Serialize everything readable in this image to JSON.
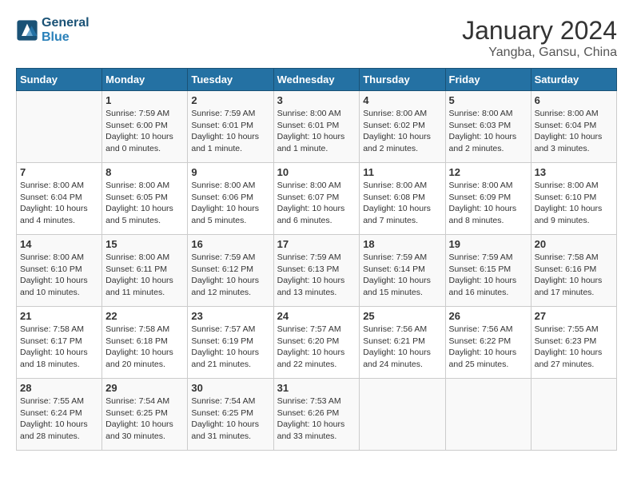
{
  "header": {
    "logo_line1": "General",
    "logo_line2": "Blue",
    "title": "January 2024",
    "subtitle": "Yangba, Gansu, China"
  },
  "days_of_week": [
    "Sunday",
    "Monday",
    "Tuesday",
    "Wednesday",
    "Thursday",
    "Friday",
    "Saturday"
  ],
  "weeks": [
    [
      {
        "day": "",
        "info": ""
      },
      {
        "day": "1",
        "info": "Sunrise: 7:59 AM\nSunset: 6:00 PM\nDaylight: 10 hours\nand 0 minutes."
      },
      {
        "day": "2",
        "info": "Sunrise: 7:59 AM\nSunset: 6:01 PM\nDaylight: 10 hours\nand 1 minute."
      },
      {
        "day": "3",
        "info": "Sunrise: 8:00 AM\nSunset: 6:01 PM\nDaylight: 10 hours\nand 1 minute."
      },
      {
        "day": "4",
        "info": "Sunrise: 8:00 AM\nSunset: 6:02 PM\nDaylight: 10 hours\nand 2 minutes."
      },
      {
        "day": "5",
        "info": "Sunrise: 8:00 AM\nSunset: 6:03 PM\nDaylight: 10 hours\nand 2 minutes."
      },
      {
        "day": "6",
        "info": "Sunrise: 8:00 AM\nSunset: 6:04 PM\nDaylight: 10 hours\nand 3 minutes."
      }
    ],
    [
      {
        "day": "7",
        "info": "Sunrise: 8:00 AM\nSunset: 6:04 PM\nDaylight: 10 hours\nand 4 minutes."
      },
      {
        "day": "8",
        "info": "Sunrise: 8:00 AM\nSunset: 6:05 PM\nDaylight: 10 hours\nand 5 minutes."
      },
      {
        "day": "9",
        "info": "Sunrise: 8:00 AM\nSunset: 6:06 PM\nDaylight: 10 hours\nand 5 minutes."
      },
      {
        "day": "10",
        "info": "Sunrise: 8:00 AM\nSunset: 6:07 PM\nDaylight: 10 hours\nand 6 minutes."
      },
      {
        "day": "11",
        "info": "Sunrise: 8:00 AM\nSunset: 6:08 PM\nDaylight: 10 hours\nand 7 minutes."
      },
      {
        "day": "12",
        "info": "Sunrise: 8:00 AM\nSunset: 6:09 PM\nDaylight: 10 hours\nand 8 minutes."
      },
      {
        "day": "13",
        "info": "Sunrise: 8:00 AM\nSunset: 6:10 PM\nDaylight: 10 hours\nand 9 minutes."
      }
    ],
    [
      {
        "day": "14",
        "info": "Sunrise: 8:00 AM\nSunset: 6:10 PM\nDaylight: 10 hours\nand 10 minutes."
      },
      {
        "day": "15",
        "info": "Sunrise: 8:00 AM\nSunset: 6:11 PM\nDaylight: 10 hours\nand 11 minutes."
      },
      {
        "day": "16",
        "info": "Sunrise: 7:59 AM\nSunset: 6:12 PM\nDaylight: 10 hours\nand 12 minutes."
      },
      {
        "day": "17",
        "info": "Sunrise: 7:59 AM\nSunset: 6:13 PM\nDaylight: 10 hours\nand 13 minutes."
      },
      {
        "day": "18",
        "info": "Sunrise: 7:59 AM\nSunset: 6:14 PM\nDaylight: 10 hours\nand 15 minutes."
      },
      {
        "day": "19",
        "info": "Sunrise: 7:59 AM\nSunset: 6:15 PM\nDaylight: 10 hours\nand 16 minutes."
      },
      {
        "day": "20",
        "info": "Sunrise: 7:58 AM\nSunset: 6:16 PM\nDaylight: 10 hours\nand 17 minutes."
      }
    ],
    [
      {
        "day": "21",
        "info": "Sunrise: 7:58 AM\nSunset: 6:17 PM\nDaylight: 10 hours\nand 18 minutes."
      },
      {
        "day": "22",
        "info": "Sunrise: 7:58 AM\nSunset: 6:18 PM\nDaylight: 10 hours\nand 20 minutes."
      },
      {
        "day": "23",
        "info": "Sunrise: 7:57 AM\nSunset: 6:19 PM\nDaylight: 10 hours\nand 21 minutes."
      },
      {
        "day": "24",
        "info": "Sunrise: 7:57 AM\nSunset: 6:20 PM\nDaylight: 10 hours\nand 22 minutes."
      },
      {
        "day": "25",
        "info": "Sunrise: 7:56 AM\nSunset: 6:21 PM\nDaylight: 10 hours\nand 24 minutes."
      },
      {
        "day": "26",
        "info": "Sunrise: 7:56 AM\nSunset: 6:22 PM\nDaylight: 10 hours\nand 25 minutes."
      },
      {
        "day": "27",
        "info": "Sunrise: 7:55 AM\nSunset: 6:23 PM\nDaylight: 10 hours\nand 27 minutes."
      }
    ],
    [
      {
        "day": "28",
        "info": "Sunrise: 7:55 AM\nSunset: 6:24 PM\nDaylight: 10 hours\nand 28 minutes."
      },
      {
        "day": "29",
        "info": "Sunrise: 7:54 AM\nSunset: 6:25 PM\nDaylight: 10 hours\nand 30 minutes."
      },
      {
        "day": "30",
        "info": "Sunrise: 7:54 AM\nSunset: 6:25 PM\nDaylight: 10 hours\nand 31 minutes."
      },
      {
        "day": "31",
        "info": "Sunrise: 7:53 AM\nSunset: 6:26 PM\nDaylight: 10 hours\nand 33 minutes."
      },
      {
        "day": "",
        "info": ""
      },
      {
        "day": "",
        "info": ""
      },
      {
        "day": "",
        "info": ""
      }
    ]
  ]
}
